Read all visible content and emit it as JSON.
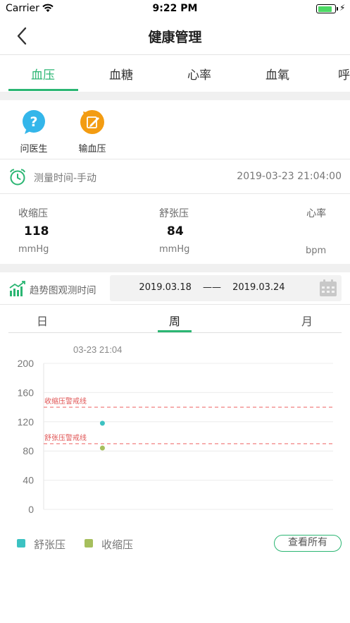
{
  "status_bar": {
    "carrier": "Carrier",
    "time": "9:22 PM",
    "battery_level": 0.85,
    "charging": true
  },
  "nav": {
    "title": "健康管理"
  },
  "tabs": [
    {
      "label": "血压",
      "active": true
    },
    {
      "label": "血糖",
      "active": false
    },
    {
      "label": "心率",
      "active": false
    },
    {
      "label": "血氧",
      "active": false
    },
    {
      "label": "呼",
      "active": false
    }
  ],
  "quick_actions": [
    {
      "label": "问医生",
      "icon": "question-icon",
      "color": "#34b6ea"
    },
    {
      "label": "输血压",
      "icon": "edit-icon",
      "color": "#f39c12"
    }
  ],
  "measurement": {
    "label": "测量时间-手动",
    "value": "2019-03-23 21:04:00"
  },
  "vitals": [
    {
      "name": "收缩压",
      "value": "118",
      "unit": "mmHg"
    },
    {
      "name": "舒张压",
      "value": "84",
      "unit": "mmHg"
    },
    {
      "name": "心率",
      "value": "",
      "unit": "bpm"
    }
  ],
  "trend": {
    "label": "趋势图观测时间",
    "start": "2019.03.18",
    "separator": "——",
    "end": "2019.03.24"
  },
  "periods": [
    {
      "label": "日",
      "active": false
    },
    {
      "label": "周",
      "active": true
    },
    {
      "label": "月",
      "active": false
    }
  ],
  "chart_data": {
    "type": "scatter",
    "tooltip": "03-23 21:04",
    "y_ticks": [
      "200",
      "160",
      "120",
      "80",
      "40",
      "0"
    ],
    "ylim": [
      0,
      200
    ],
    "grid": true,
    "thresholds": [
      {
        "label": "收缩压警戒线",
        "value": 140,
        "color": "#f08080"
      },
      {
        "label": "舒张压警戒线",
        "value": 90,
        "color": "#f08080"
      }
    ],
    "x_position_fraction": 0.203,
    "series": [
      {
        "name": "舒张压",
        "values": [
          118
        ],
        "color": "#3cc2c2"
      },
      {
        "name": "收缩压",
        "values": [
          84
        ],
        "color": "#a6bf5d"
      }
    ]
  },
  "legend": {
    "items": [
      {
        "name": "舒张压",
        "color": "#3cc2c2"
      },
      {
        "name": "收缩压",
        "color": "#a6bf5d"
      }
    ],
    "view_all": "查看所有"
  },
  "colors": {
    "accent": "#2bb673",
    "warning_line": "#f08080"
  }
}
